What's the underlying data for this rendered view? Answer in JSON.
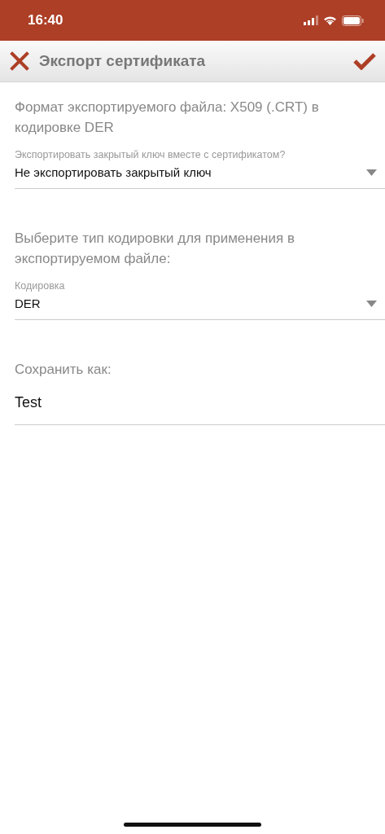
{
  "status_bar": {
    "time": "16:40"
  },
  "toolbar": {
    "title": "Экспорт сертификата"
  },
  "sections": [
    {
      "kind": "select",
      "description": "Формат экспортируемого файла: X509 (.CRT) в кодировке DER",
      "label": "Экспортировать закрытый ключ вместе с сертификатом?",
      "value": "Не экспортировать закрытый ключ"
    },
    {
      "kind": "select",
      "description": "Выберите тип кодировки для применения в экспортируемом файле:",
      "label": "Кодировка",
      "value": "DER"
    },
    {
      "kind": "input",
      "description": "Сохранить как:",
      "value": "Test"
    }
  ]
}
